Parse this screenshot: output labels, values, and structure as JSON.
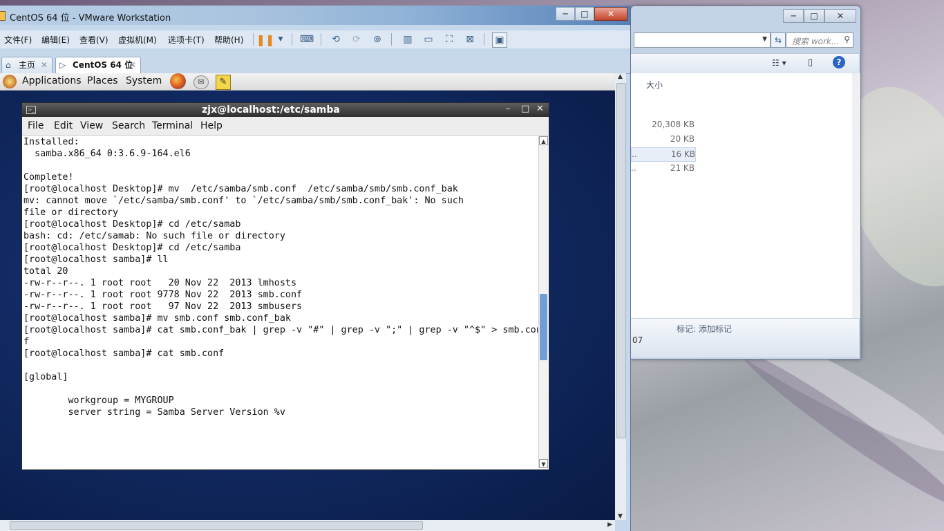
{
  "explorer": {
    "search_placeholder": "搜索 work...",
    "column_size": "大小",
    "rows": [
      {
        "size": "20,308 KB",
        "prefix": ""
      },
      {
        "size": "20 KB",
        "prefix": ""
      },
      {
        "size": "16 KB",
        "prefix": "..",
        "selected": true
      },
      {
        "size": "21 KB",
        "prefix": ".."
      }
    ],
    "details_tag": "标记: 添加标记",
    "details_year": "07"
  },
  "vmware": {
    "title": "CentOS 64 位 - VMware Workstation",
    "menu": [
      "文件(F)",
      "编辑(E)",
      "查看(V)",
      "虚拟机(M)",
      "选项卡(T)",
      "帮助(H)"
    ],
    "tabs": {
      "home": "主页",
      "vm": "CentOS 64 位"
    }
  },
  "gnome_panel": {
    "items": [
      "Applications",
      "Places",
      "System"
    ]
  },
  "terminal": {
    "title": "zjx@localhost:/etc/samba",
    "menu": [
      "File",
      "Edit",
      "View",
      "Search",
      "Terminal",
      "Help"
    ],
    "lines": [
      "Installed:",
      "  samba.x86_64 0:3.6.9-164.el6",
      "",
      "Complete!",
      "[root@localhost Desktop]# mv  /etc/samba/smb.conf  /etc/samba/smb/smb.conf_bak",
      "mv: cannot move `/etc/samba/smb.conf' to `/etc/samba/smb/smb.conf_bak': No such",
      "file or directory",
      "[root@localhost Desktop]# cd /etc/samab",
      "bash: cd: /etc/samab: No such file or directory",
      "[root@localhost Desktop]# cd /etc/samba",
      "[root@localhost samba]# ll",
      "total 20",
      "-rw-r--r--. 1 root root   20 Nov 22  2013 lmhosts",
      "-rw-r--r--. 1 root root 9778 Nov 22  2013 smb.conf",
      "-rw-r--r--. 1 root root   97 Nov 22  2013 smbusers",
      "[root@localhost samba]# mv smb.conf smb.conf_bak",
      "[root@localhost samba]# cat smb.conf_bak | grep -v \"#\" | grep -v \";\" | grep -v \"^$\" > smb.con",
      "f",
      "[root@localhost samba]# cat smb.conf",
      "",
      "[global]",
      "",
      "        workgroup = MYGROUP",
      "        server string = Samba Server Version %v"
    ]
  }
}
